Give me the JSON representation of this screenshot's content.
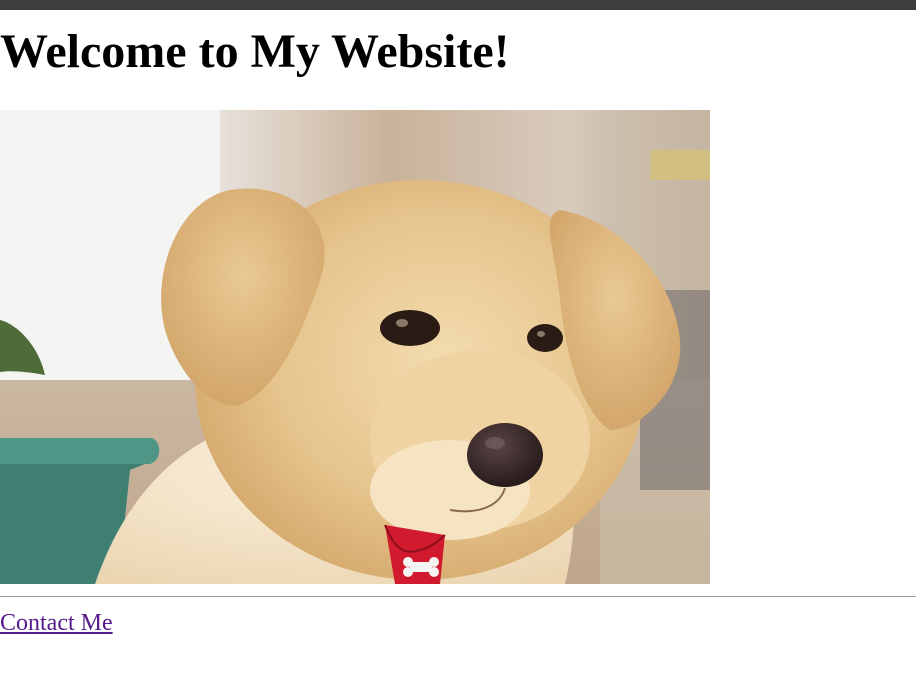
{
  "page": {
    "title": "Welcome to My Website!"
  },
  "hero_image": {
    "description_icon": "puppy-photo"
  },
  "footer": {
    "contact_link": "Contact Me"
  },
  "colors": {
    "top_bar": "#3d3d3d",
    "link_visited": "#551a8b",
    "rule": "#9a9a9a"
  }
}
